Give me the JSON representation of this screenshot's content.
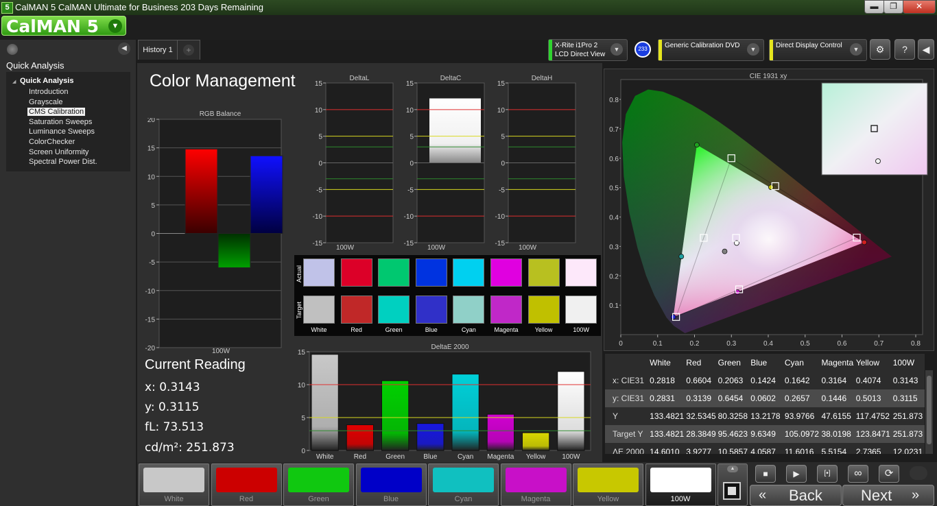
{
  "window": {
    "title": "CalMAN 5 CalMAN Ultimate for Business 203 Days Remaining",
    "app_icon_label": "5",
    "minimize": "▬",
    "maximize": "❐",
    "close": "✕"
  },
  "logo": {
    "text": "CalMAN 5"
  },
  "sidebar": {
    "heading": "Quick Analysis",
    "root": "Quick Analysis",
    "items": [
      "Introduction",
      "Grayscale",
      "CMS Calibration",
      "Saturation Sweeps",
      "Luminance Sweeps",
      "ColorChecker",
      "Screen Uniformity",
      "Spectral Power Dist."
    ],
    "active_index": 2
  },
  "tabs": [
    {
      "label": "History 1"
    }
  ],
  "devices": [
    {
      "line1": "X-Rite i1Pro 2",
      "line2": "LCD Direct View",
      "bar_color": "#2fd32f"
    },
    {
      "line1": "Generic Calibration DVD",
      "line2": "",
      "bar_color": "#e6e61e"
    },
    {
      "line1": "Direct Display Control",
      "line2": "",
      "bar_color": "#e6e61e"
    }
  ],
  "badge": "233",
  "page_title": "Color Management",
  "rgb_balance": {
    "title": "RGB Balance",
    "ylim": [
      -20,
      20
    ],
    "ticks": [
      "20",
      "15",
      "10",
      "5",
      "0",
      "-5",
      "-10",
      "-15",
      "-20"
    ],
    "xlabel": "100W",
    "bars": [
      {
        "name": "red",
        "value": 14.8,
        "color": "#ff0000"
      },
      {
        "name": "green",
        "value": -6.0,
        "color": "#00a000"
      },
      {
        "name": "blue",
        "value": 13.6,
        "color": "#1010ff"
      }
    ]
  },
  "delta_charts": [
    {
      "title": "DeltaL",
      "xlabel": "100W",
      "value": 0
    },
    {
      "title": "DeltaC",
      "xlabel": "100W",
      "value": 12.1
    },
    {
      "title": "DeltaH",
      "xlabel": "100W",
      "value": 0
    }
  ],
  "delta_ticks": [
    "15",
    "10",
    "5",
    "0",
    "-5",
    "-10",
    "-15"
  ],
  "swatches": {
    "row_labels": [
      "Actual",
      "Target"
    ],
    "labels": [
      "White",
      "Red",
      "Green",
      "Blue",
      "Cyan",
      "Magenta",
      "Yellow",
      "100W"
    ],
    "actual": [
      "#c0c2e8",
      "#dc0028",
      "#00c870",
      "#0033e0",
      "#00d0f0",
      "#e000e0",
      "#b8c020",
      "#fde8fa"
    ],
    "target": [
      "#c0c0c0",
      "#c02828",
      "#00d0c0",
      "#3030c8",
      "#90d0c8",
      "#c028c8",
      "#c0c000",
      "#f0f0f0"
    ]
  },
  "deltae": {
    "title": "DeltaE 2000",
    "ylim": [
      0,
      15
    ],
    "ticks": [
      "15",
      "10",
      "5",
      "0"
    ],
    "categories": [
      "White",
      "Red",
      "Green",
      "Blue",
      "Cyan",
      "Magenta",
      "Yellow",
      "100W"
    ],
    "values": [
      14.6,
      3.9,
      10.6,
      4.1,
      11.6,
      5.5,
      2.7,
      12.0
    ],
    "colors": [
      "#c8c8c8",
      "#e00000",
      "#00d000",
      "#1818e0",
      "#00d0d8",
      "#d000d0",
      "#d8d800",
      "#ffffff"
    ]
  },
  "current_reading": {
    "title": "Current Reading",
    "x": "x: 0.3143",
    "y": "y: 0.3115",
    "fl": "fL: 73.513",
    "cd": "cd/m²: 251.873"
  },
  "cie": {
    "title": "CIE 1931 xy",
    "xticks": [
      "0",
      "0.1",
      "0.2",
      "0.3",
      "0.4",
      "0.5",
      "0.6",
      "0.7",
      "0.8"
    ],
    "yticks": [
      "0.8",
      "0.7",
      "0.6",
      "0.5",
      "0.4",
      "0.3",
      "0.2",
      "0.1",
      "0"
    ],
    "targets": [
      [
        0.64,
        0.33
      ],
      [
        0.3,
        0.6
      ],
      [
        0.15,
        0.06
      ],
      [
        0.225,
        0.329
      ],
      [
        0.321,
        0.154
      ],
      [
        0.419,
        0.505
      ],
      [
        0.3127,
        0.329
      ]
    ],
    "measured": [
      [
        0.6604,
        0.3139
      ],
      [
        0.2063,
        0.6454
      ],
      [
        0.1424,
        0.0602
      ],
      [
        0.1642,
        0.2657
      ],
      [
        0.3164,
        0.1446
      ],
      [
        0.4074,
        0.5013
      ],
      [
        0.3143,
        0.3115
      ],
      [
        0.2818,
        0.2831
      ]
    ]
  },
  "table": {
    "headers": [
      "",
      "White",
      "Red",
      "Green",
      "Blue",
      "Cyan",
      "Magenta",
      "Yellow",
      "100W"
    ],
    "rows": [
      [
        "x: CIE31",
        "0.2818",
        "0.6604",
        "0.2063",
        "0.1424",
        "0.1642",
        "0.3164",
        "0.4074",
        "0.3143"
      ],
      [
        "y: CIE31",
        "0.2831",
        "0.3139",
        "0.6454",
        "0.0602",
        "0.2657",
        "0.1446",
        "0.5013",
        "0.3115"
      ],
      [
        "Y",
        "133.4821",
        "32.5345",
        "80.3258",
        "13.2178",
        "93.9766",
        "47.6155",
        "117.4752",
        "251.873"
      ],
      [
        "Target Y",
        "133.4821",
        "28.3849",
        "95.4623",
        "9.6349",
        "105.0972",
        "38.0198",
        "123.8471",
        "251.873"
      ],
      [
        "ΔE 2000",
        "14.6010",
        "3.9277",
        "10.5857",
        "4.0587",
        "11.6016",
        "5.5154",
        "2.7365",
        "12.0231"
      ]
    ]
  },
  "bottom_swatches": [
    {
      "label": "White",
      "color": "#c8c8c8"
    },
    {
      "label": "Red",
      "color": "#cc0000"
    },
    {
      "label": "Green",
      "color": "#10c810"
    },
    {
      "label": "Blue",
      "color": "#0000c8"
    },
    {
      "label": "Cyan",
      "color": "#10c0c0"
    },
    {
      "label": "Magenta",
      "color": "#c810c8"
    },
    {
      "label": "Yellow",
      "color": "#c8c800"
    },
    {
      "label": "100W",
      "color": "#ffffff"
    }
  ],
  "controls": {
    "stop": "■",
    "play": "▶",
    "fit": "[•]",
    "loop": "∞",
    "refresh": "⟳",
    "back": "Back",
    "next": "Next",
    "back_arrow": "«",
    "next_arrow": "»"
  }
}
